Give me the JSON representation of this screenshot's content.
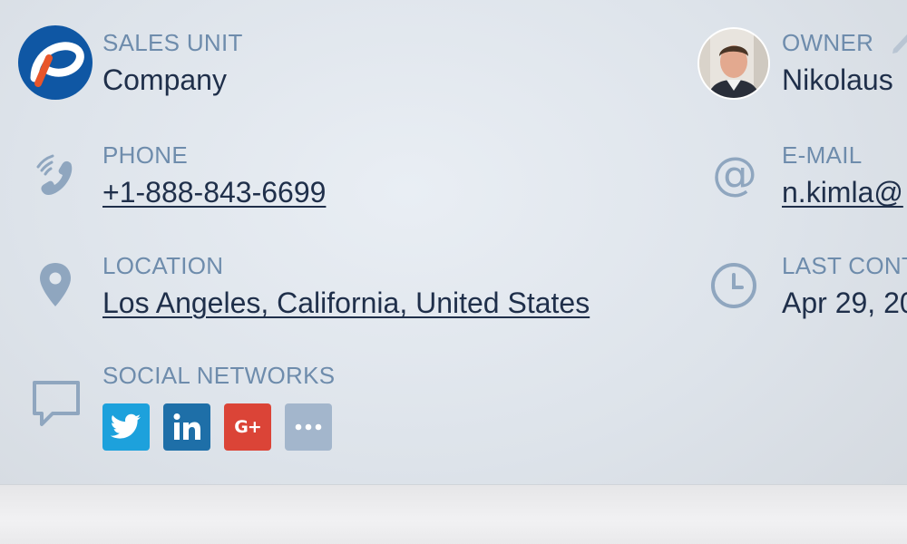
{
  "sales_unit": {
    "label": "SALES UNIT",
    "value": "Company",
    "icon": "company-logo-icon"
  },
  "owner": {
    "label": "OWNER",
    "value": "Nikolaus",
    "avatar": "owner-avatar",
    "edit_icon": "pencil-icon"
  },
  "phone": {
    "label": "PHONE",
    "value": "+1-888-843-6699",
    "icon": "phone-icon"
  },
  "email": {
    "label": "E-MAIL",
    "value": "n.kimla@",
    "icon": "at-sign-icon"
  },
  "location": {
    "label": "LOCATION",
    "value": "Los Angeles, California, United States",
    "icon": "map-pin-icon"
  },
  "last_contact": {
    "label": "LAST CONT",
    "value": "Apr 29, 20",
    "icon": "clock-icon"
  },
  "social": {
    "label": "SOCIAL NETWORKS",
    "icon": "speech-bubble-icon",
    "networks": [
      {
        "name": "twitter",
        "icon": "twitter-icon",
        "color": "#1da1dc"
      },
      {
        "name": "linkedin",
        "icon": "linkedin-icon",
        "color": "#1e6fa8"
      },
      {
        "name": "google-plus",
        "icon": "google-plus-icon",
        "text": "G+",
        "color": "#db4437"
      },
      {
        "name": "more",
        "icon": "more-icon",
        "color": "#a3b6cc"
      }
    ]
  },
  "colors": {
    "label": "#6e8cac",
    "value": "#1f2f4a",
    "icon": "#8fa6bf"
  }
}
